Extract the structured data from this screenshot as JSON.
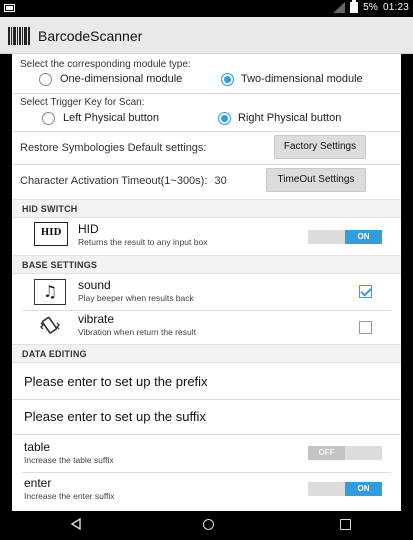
{
  "status_bar": {
    "battery": "5%",
    "time": "01:23"
  },
  "app": {
    "title": "BarcodeScanner"
  },
  "module_type": {
    "label": "Select the corresponding module type:",
    "options": [
      "One-dimensional module",
      "Two-dimensional module"
    ],
    "selected": "Two-dimensional module"
  },
  "trigger_key": {
    "label": "Select Trigger Key for Scan:",
    "options": [
      "Left Physical button",
      "Right Physical button"
    ],
    "selected": "Right Physical button"
  },
  "restore": {
    "label": "Restore Symbologies Default settings:",
    "button": "Factory Settings"
  },
  "timeout": {
    "label": "Character Activation Timeout(1~300s):",
    "value": "30",
    "button": "TimeOut Settings"
  },
  "hid_switch": {
    "header": "HID SWITCH",
    "icon_text": "HID",
    "title": "HID",
    "desc": "Returns the result to any input box",
    "toggle": "ON"
  },
  "base_settings": {
    "header": "BASE SETTINGS",
    "sound": {
      "title": "sound",
      "desc": "Play beeper when results back",
      "checked": true
    },
    "vibrate": {
      "title": "vibrate",
      "desc": "Vibration when return the result",
      "checked": false
    }
  },
  "data_editing": {
    "header": "DATA EDITING",
    "prefix": "Please enter to set up the prefix",
    "suffix": "Please enter to set up the suffix",
    "table": {
      "title": "table",
      "desc": "Increase the table suffix",
      "toggle": "OFF"
    },
    "enter": {
      "title": "enter",
      "desc": "Increase the enter suffix",
      "toggle": "ON"
    }
  },
  "colors": {
    "accent": "#2f9de1",
    "appbar": "#e9e9e9",
    "section": "#f2f2f2"
  }
}
